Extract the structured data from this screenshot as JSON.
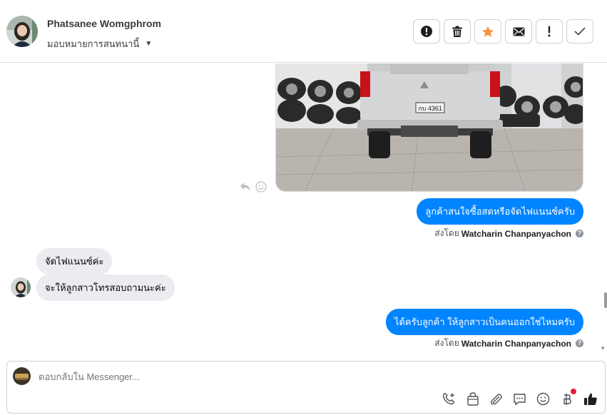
{
  "header": {
    "contact_name": "Phatsanee Womgphrom",
    "assign_label": "มอบหมายการสนทนานี้",
    "actions": [
      {
        "name": "spam-button",
        "icon": "alert-circle-icon"
      },
      {
        "name": "delete-button",
        "icon": "trash-icon"
      },
      {
        "name": "star-button",
        "icon": "star-icon"
      },
      {
        "name": "mark-unread-button",
        "icon": "envelope-icon"
      },
      {
        "name": "follow-up-button",
        "icon": "exclamation-icon"
      },
      {
        "name": "done-button",
        "icon": "check-icon"
      }
    ]
  },
  "conversation": {
    "messages": [
      {
        "direction": "out",
        "text": "ลูกค้าสนใจซื้อสดหรือจัดไฟแนนซ์ครับ"
      },
      {
        "direction": "out-meta",
        "prefix": "ส่งโดย",
        "sender": "Watcharin Chanpanyachon",
        "help": "?"
      },
      {
        "direction": "in",
        "text": "จัดไฟแนนซ์ค่ะ"
      },
      {
        "direction": "in",
        "text": "จะให้ลูกสาวโทรสอบถามนะค่ะ"
      },
      {
        "direction": "out",
        "text": "ได้ครับลูกค้า ให้ลูกสาวเป็นคนออกใช่ไหมครับ"
      },
      {
        "direction": "out-meta",
        "prefix": "ส่งโดย",
        "sender": "Watcharin Chanpanyachon",
        "help": "?"
      }
    ],
    "photo_plate": "กบ 4361"
  },
  "composer": {
    "placeholder": "ตอบกลับใน Messenger...",
    "tools": [
      "phone-plus-icon",
      "shopping-bag-icon",
      "paperclip-icon",
      "saved-reply-icon",
      "emoji-icon",
      "baht-icon",
      "thumbs-up-icon"
    ]
  },
  "colors": {
    "outgoing_bubble": "#0084ff",
    "incoming_bubble": "#eaecef",
    "star": "#f7923b",
    "notification_dot": "#e41e3f"
  }
}
